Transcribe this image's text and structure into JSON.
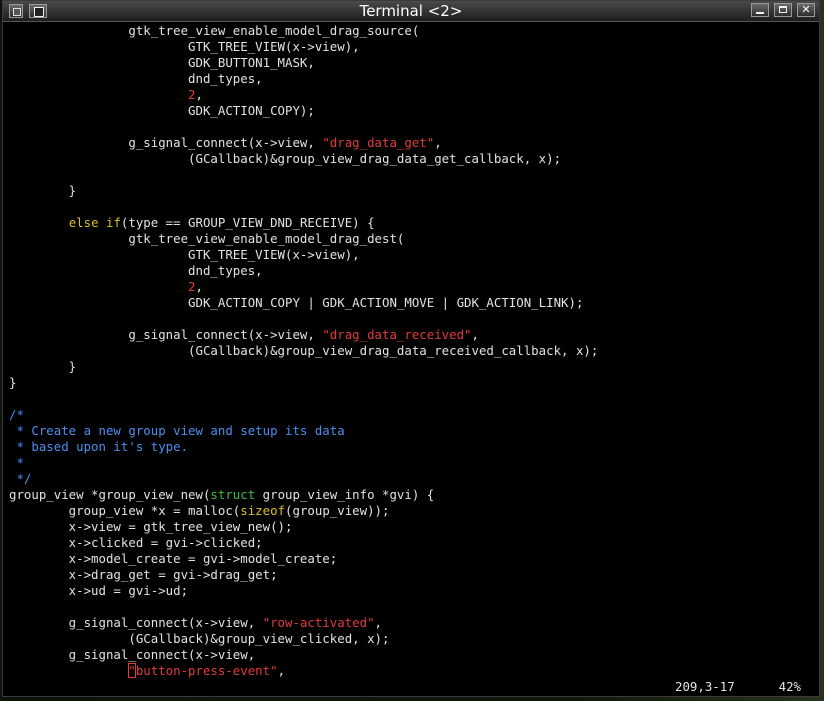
{
  "window": {
    "title": "Terminal <2>"
  },
  "titlebar_buttons": [
    {
      "name": "window-menu-button",
      "icon": "window-menu-icon"
    },
    {
      "name": "sticky-button",
      "icon": "sticky-icon"
    },
    {
      "name": "minimize-button",
      "icon": "minimize-icon"
    },
    {
      "name": "maximize-button",
      "icon": "maximize-icon"
    },
    {
      "name": "close-button",
      "icon": "close-icon"
    }
  ],
  "colors": {
    "foreground": "#e2e2e2",
    "keyword": "#d8c020",
    "type": "#3cbf3c",
    "string": "#e03a3a",
    "number": "#e03a3a",
    "comment": "#4a8ff0",
    "background": "#000000"
  },
  "code_lines": [
    [
      {
        "t": "                gtk_tree_view_enable_model_drag_source(",
        "k": "n"
      }
    ],
    [
      {
        "t": "                        GTK_TREE_VIEW(x->view),",
        "k": "n"
      }
    ],
    [
      {
        "t": "                        GDK_BUTTON1_MASK,",
        "k": "n"
      }
    ],
    [
      {
        "t": "                        dnd_types,",
        "k": "n"
      }
    ],
    [
      {
        "t": "                        ",
        "k": "n"
      },
      {
        "t": "2",
        "k": "num"
      },
      {
        "t": ",",
        "k": "n"
      }
    ],
    [
      {
        "t": "                        GDK_ACTION_COPY);",
        "k": "n"
      }
    ],
    [],
    [
      {
        "t": "                g_signal_connect(x->view, ",
        "k": "n"
      },
      {
        "t": "\"drag_data_get\"",
        "k": "str"
      },
      {
        "t": ",",
        "k": "n"
      }
    ],
    [
      {
        "t": "                        (GCallback)&group_view_drag_data_get_callback, x);",
        "k": "n"
      }
    ],
    [],
    [
      {
        "t": "        }",
        "k": "n"
      }
    ],
    [],
    [
      {
        "t": "        ",
        "k": "n"
      },
      {
        "t": "else if",
        "k": "kw"
      },
      {
        "t": "(type == GROUP_VIEW_DND_RECEIVE) {",
        "k": "n"
      }
    ],
    [
      {
        "t": "                gtk_tree_view_enable_model_drag_dest(",
        "k": "n"
      }
    ],
    [
      {
        "t": "                        GTK_TREE_VIEW(x->view),",
        "k": "n"
      }
    ],
    [
      {
        "t": "                        dnd_types,",
        "k": "n"
      }
    ],
    [
      {
        "t": "                        ",
        "k": "n"
      },
      {
        "t": "2",
        "k": "num"
      },
      {
        "t": ",",
        "k": "n"
      }
    ],
    [
      {
        "t": "                        GDK_ACTION_COPY | GDK_ACTION_MOVE | GDK_ACTION_LINK);",
        "k": "n"
      }
    ],
    [],
    [
      {
        "t": "                g_signal_connect(x->view, ",
        "k": "n"
      },
      {
        "t": "\"drag_data_received\"",
        "k": "str"
      },
      {
        "t": ",",
        "k": "n"
      }
    ],
    [
      {
        "t": "                        (GCallback)&group_view_drag_data_received_callback, x);",
        "k": "n"
      }
    ],
    [
      {
        "t": "        }",
        "k": "n"
      }
    ],
    [
      {
        "t": "}",
        "k": "n"
      }
    ],
    [],
    [
      {
        "t": "/*",
        "k": "cm"
      }
    ],
    [
      {
        "t": " * Create a new group view and setup its data",
        "k": "cm"
      }
    ],
    [
      {
        "t": " * based upon it's type.",
        "k": "cm"
      }
    ],
    [
      {
        "t": " *",
        "k": "cm"
      }
    ],
    [
      {
        "t": " */",
        "k": "cm"
      }
    ],
    [
      {
        "t": "group_view *group_view_new(",
        "k": "n"
      },
      {
        "t": "struct",
        "k": "type"
      },
      {
        "t": " group_view_info *gvi) {",
        "k": "n"
      }
    ],
    [
      {
        "t": "        group_view *x = malloc(",
        "k": "n"
      },
      {
        "t": "sizeof",
        "k": "kw"
      },
      {
        "t": "(group_view));",
        "k": "n"
      }
    ],
    [
      {
        "t": "        x->view = gtk_tree_view_new();",
        "k": "n"
      }
    ],
    [
      {
        "t": "        x->clicked = gvi->clicked;",
        "k": "n"
      }
    ],
    [
      {
        "t": "        x->model_create = gvi->model_create;",
        "k": "n"
      }
    ],
    [
      {
        "t": "        x->drag_get = gvi->drag_get;",
        "k": "n"
      }
    ],
    [
      {
        "t": "        x->ud = gvi->ud;",
        "k": "n"
      }
    ],
    [],
    [
      {
        "t": "        g_signal_connect(x->view, ",
        "k": "n"
      },
      {
        "t": "\"row-activated\"",
        "k": "str"
      },
      {
        "t": ",",
        "k": "n"
      }
    ],
    [
      {
        "t": "                (GCallback)&group_view_clicked, x);",
        "k": "n"
      }
    ],
    [
      {
        "t": "        g_signal_connect(x->view,",
        "k": "n"
      }
    ],
    [
      {
        "t": "                ",
        "k": "n"
      },
      {
        "t": "\"",
        "k": "cur"
      },
      {
        "t": "button-press-event\"",
        "k": "str"
      },
      {
        "t": ",",
        "k": "n"
      }
    ]
  ],
  "status": {
    "position": "209,3-17",
    "percent": "42%"
  }
}
